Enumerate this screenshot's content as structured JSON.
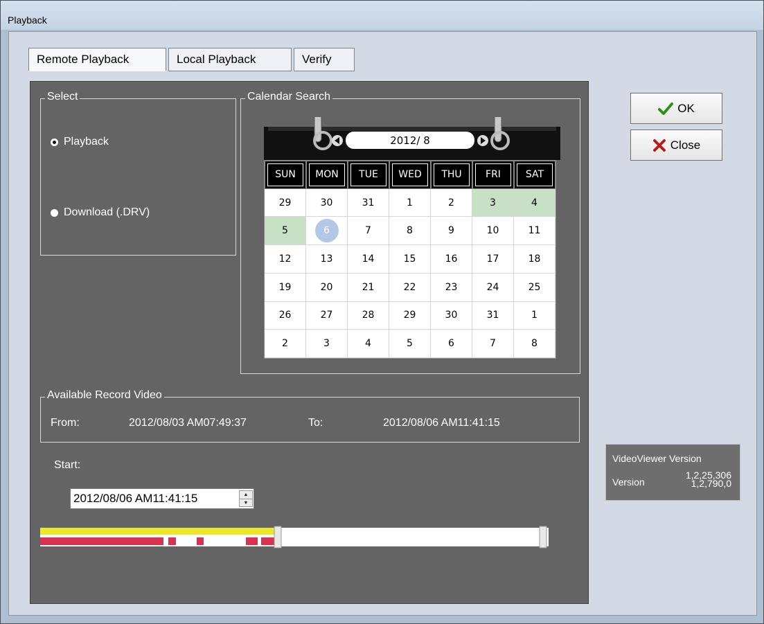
{
  "window": {
    "title": "Playback"
  },
  "tabs": [
    {
      "label": "Remote Playback",
      "active": true
    },
    {
      "label": "Local Playback",
      "active": false
    },
    {
      "label": "Verify",
      "active": false
    }
  ],
  "select_group": {
    "title": "Select",
    "options": [
      {
        "label": "Playback",
        "checked": true
      },
      {
        "label": "Download (.DRV)",
        "checked": false
      }
    ]
  },
  "calendar": {
    "title": "Calendar Search",
    "month_label": "2012/ 8",
    "weekdays": [
      "SUN",
      "MON",
      "TUE",
      "WED",
      "THU",
      "FRI",
      "SAT"
    ],
    "days": [
      "29",
      "30",
      "31",
      "1",
      "2",
      "3",
      "4",
      "5",
      "6",
      "7",
      "8",
      "9",
      "10",
      "11",
      "12",
      "13",
      "14",
      "15",
      "16",
      "17",
      "18",
      "19",
      "20",
      "21",
      "22",
      "23",
      "24",
      "25",
      "26",
      "27",
      "28",
      "29",
      "30",
      "31",
      "1",
      "2",
      "3",
      "4",
      "5",
      "6",
      "7",
      "8"
    ],
    "recorded_cells": [
      5,
      6,
      7
    ],
    "selected_cell": 8,
    "colors": {
      "recorded": "#c8e0c6",
      "selected": "#b3c7e6"
    }
  },
  "available": {
    "title": "Available Record Video",
    "from_label": "From:",
    "from_value": "2012/08/03 AM07:49:37",
    "to_label": "To:",
    "to_value": "2012/08/06 AM11:41:15"
  },
  "start": {
    "label": "Start:",
    "value": "2012/08/06 AM11:41:15"
  },
  "buttons": {
    "ok_label": "OK",
    "close_label": "Close"
  },
  "version_info": {
    "title": "VideoViewer Version",
    "label": "Version",
    "line1": "1,2,25,306",
    "line2": "1,2,790,0"
  },
  "timeline": {
    "position_fraction": 0.48,
    "colors": {
      "available": "#ece62e",
      "recorded": "#d8324f"
    }
  }
}
